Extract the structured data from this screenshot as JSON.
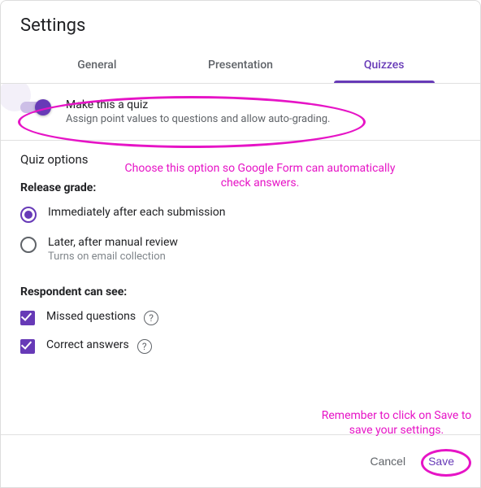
{
  "dialog": {
    "title": "Settings"
  },
  "tabs": {
    "general": "General",
    "presentation": "Presentation",
    "quizzes": "Quizzes"
  },
  "toggle": {
    "label": "Make this a quiz",
    "description": "Assign point values to questions and allow auto-grading."
  },
  "quiz_options": {
    "title": "Quiz options",
    "release_grade_label": "Release grade:",
    "release_options": {
      "immediate": "Immediately after each submission",
      "later": "Later, after manual review",
      "later_sub": "Turns on email collection"
    },
    "respondent_label": "Respondent can see:",
    "respondent_options": {
      "missed": "Missed questions",
      "correct": "Correct answers"
    }
  },
  "footer": {
    "cancel": "Cancel",
    "save": "Save"
  },
  "annotations": {
    "callout1": "Choose this option so Google Form can automatically check answers.",
    "callout2": "Remember to click on Save to save your settings."
  }
}
